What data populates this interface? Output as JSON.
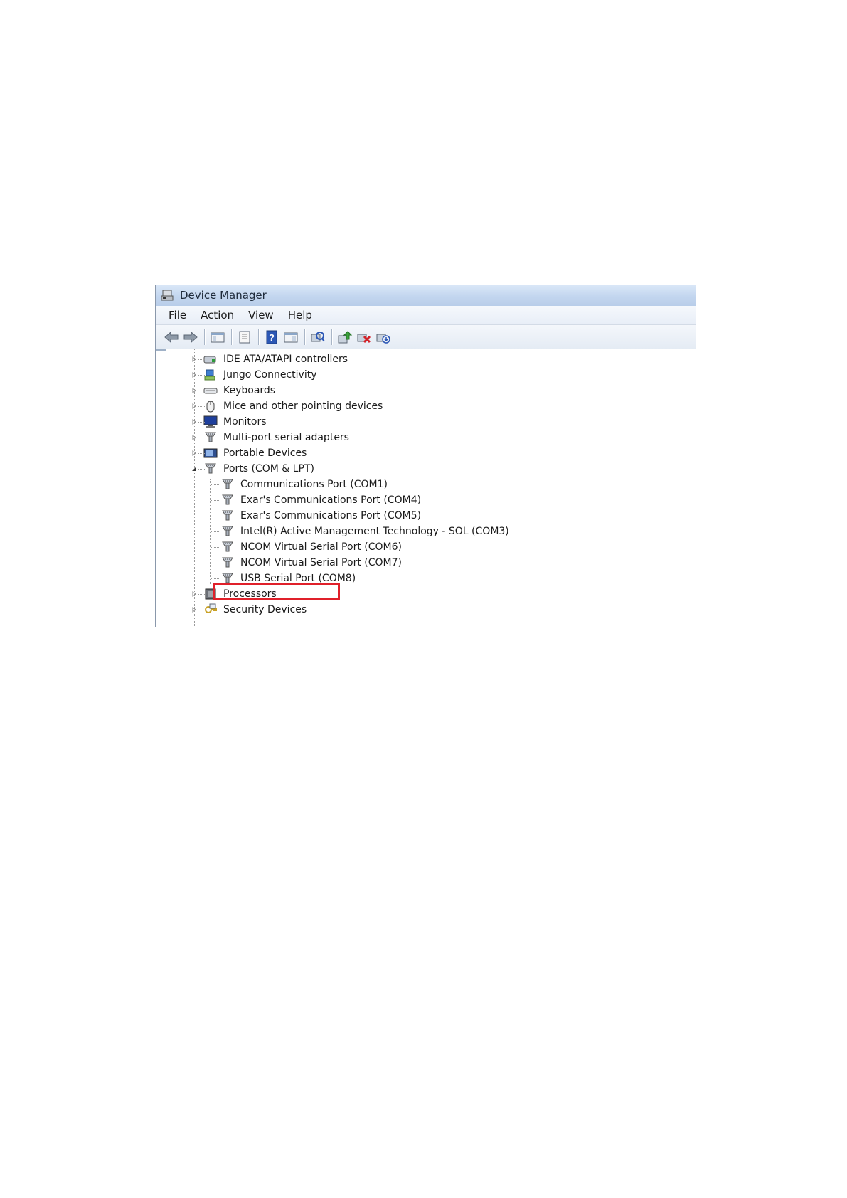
{
  "window": {
    "title": "Device Manager"
  },
  "menu": [
    "File",
    "Action",
    "View",
    "Help"
  ],
  "toolbar": {
    "buttons": [
      "back-icon",
      "forward-icon",
      "show-hide-console-tree-icon",
      "properties-icon",
      "help-icon",
      "show-action-pane-icon",
      "scan-hardware-icon",
      "update-driver-icon",
      "uninstall-icon",
      "disable-icon"
    ]
  },
  "tree": {
    "categories": [
      {
        "label": "IDE ATA/ATAPI controllers",
        "icon": "ide-controller-icon",
        "expanded": false
      },
      {
        "label": "Jungo Connectivity",
        "icon": "network-device-icon",
        "expanded": false
      },
      {
        "label": "Keyboards",
        "icon": "keyboard-icon",
        "expanded": false
      },
      {
        "label": "Mice and other pointing devices",
        "icon": "mouse-icon",
        "expanded": false
      },
      {
        "label": "Monitors",
        "icon": "monitor-icon",
        "expanded": false
      },
      {
        "label": "Multi-port serial adapters",
        "icon": "serial-port-icon",
        "expanded": false
      },
      {
        "label": "Portable Devices",
        "icon": "portable-device-icon",
        "expanded": false
      },
      {
        "label": "Ports (COM & LPT)",
        "icon": "serial-port-icon",
        "expanded": true
      }
    ],
    "ports": [
      "Communications Port (COM1)",
      "Exar's Communications Port (COM4)",
      "Exar's Communications Port (COM5)",
      "Intel(R) Active Management Technology - SOL (COM3)",
      "NCOM Virtual Serial Port (COM6)",
      "NCOM Virtual Serial Port (COM7)",
      "USB Serial Port (COM8)"
    ],
    "after": [
      {
        "label": "Processors",
        "icon": "processor-icon",
        "expanded": false
      },
      {
        "label": "Security Devices",
        "icon": "security-device-icon",
        "expanded": false
      }
    ]
  },
  "highlight": {
    "color": "#e0202a",
    "target": "USB Serial Port (COM8)"
  }
}
